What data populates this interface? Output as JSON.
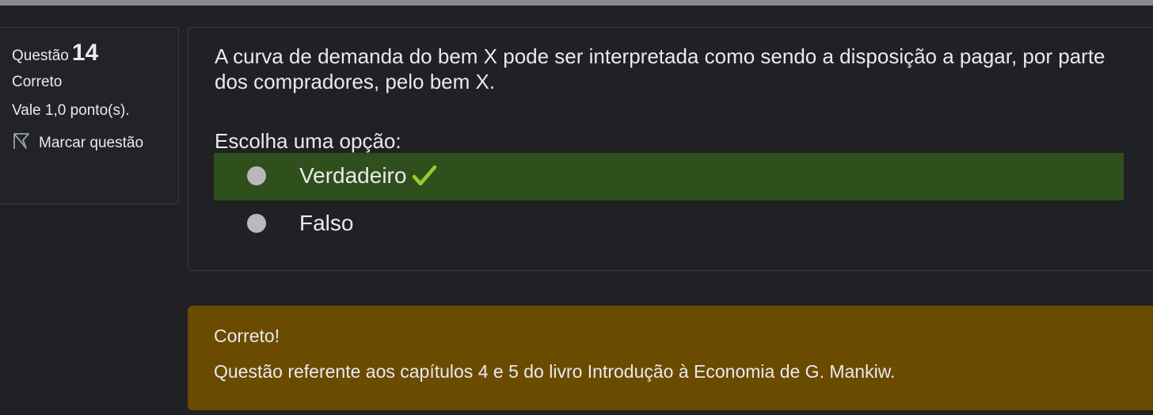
{
  "question_info": {
    "label": "Questão",
    "number": "14",
    "state": "Correto",
    "grade": "Vale 1,0 ponto(s).",
    "flag_label": "Marcar questão"
  },
  "question": {
    "text": "A curva de demanda do bem X pode ser interpretada como sendo a disposição a pagar, por parte dos compradores, pelo bem X.",
    "prompt": "Escolha uma opção:",
    "options": [
      {
        "label": "Verdadeiro",
        "status": "correct",
        "selected": false
      },
      {
        "label": "Falso",
        "status": "none",
        "selected": false
      }
    ]
  },
  "feedback": {
    "title": "Correto!",
    "text": "Questão referente aos capítulos 4 e 5 do livro Introdução à Economia de G. Mankiw."
  },
  "colors": {
    "page_background": "#202124",
    "correct_option_background": "#2f4f1c",
    "feedback_background": "#6b4b00",
    "check_mark": "#8fce32"
  },
  "icons": {
    "flag": "flag-icon",
    "correct": "check-icon"
  }
}
